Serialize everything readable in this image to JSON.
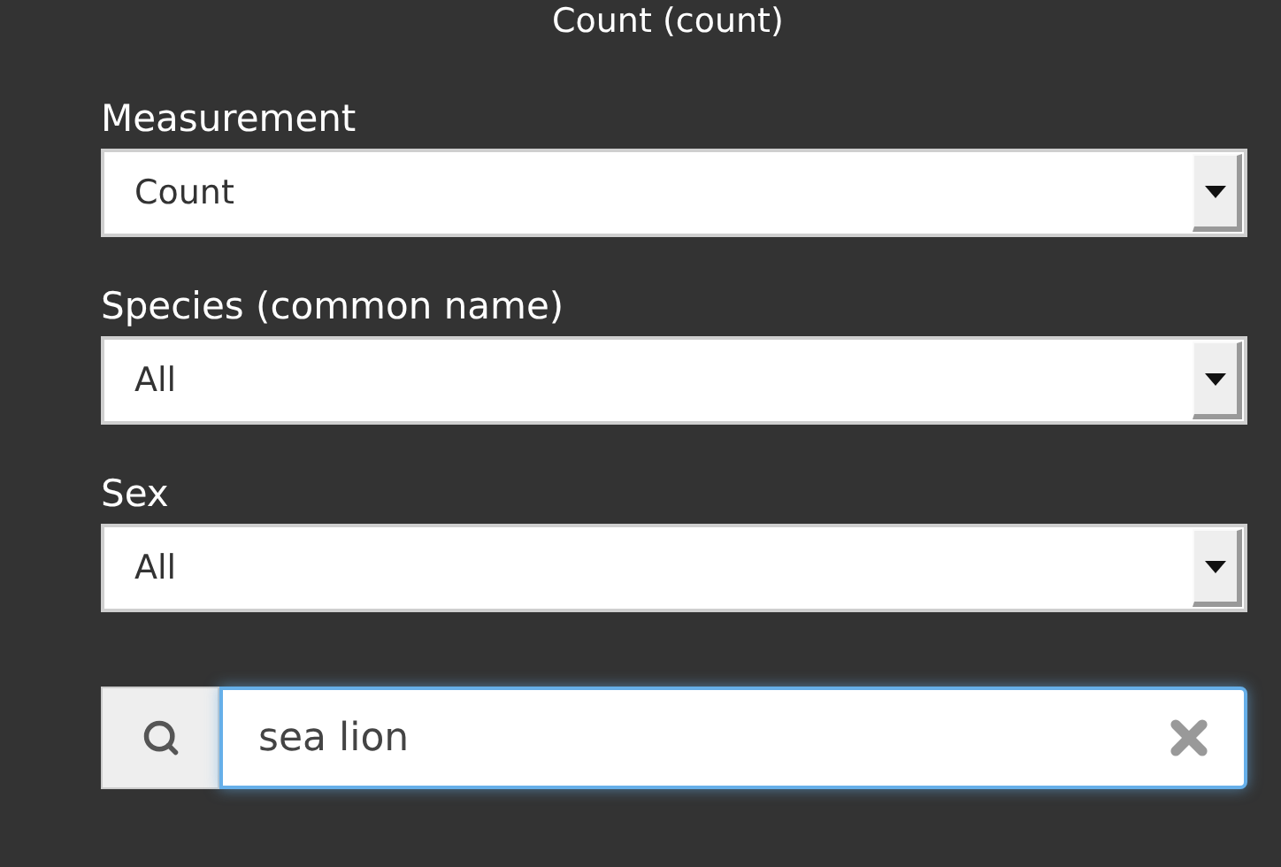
{
  "title": "Count (count)",
  "fields": [
    {
      "label": "Measurement",
      "value": "Count"
    },
    {
      "label": "Species (common name)",
      "value": "All"
    },
    {
      "label": "Sex",
      "value": "All"
    }
  ],
  "search": {
    "value": "sea lion"
  }
}
